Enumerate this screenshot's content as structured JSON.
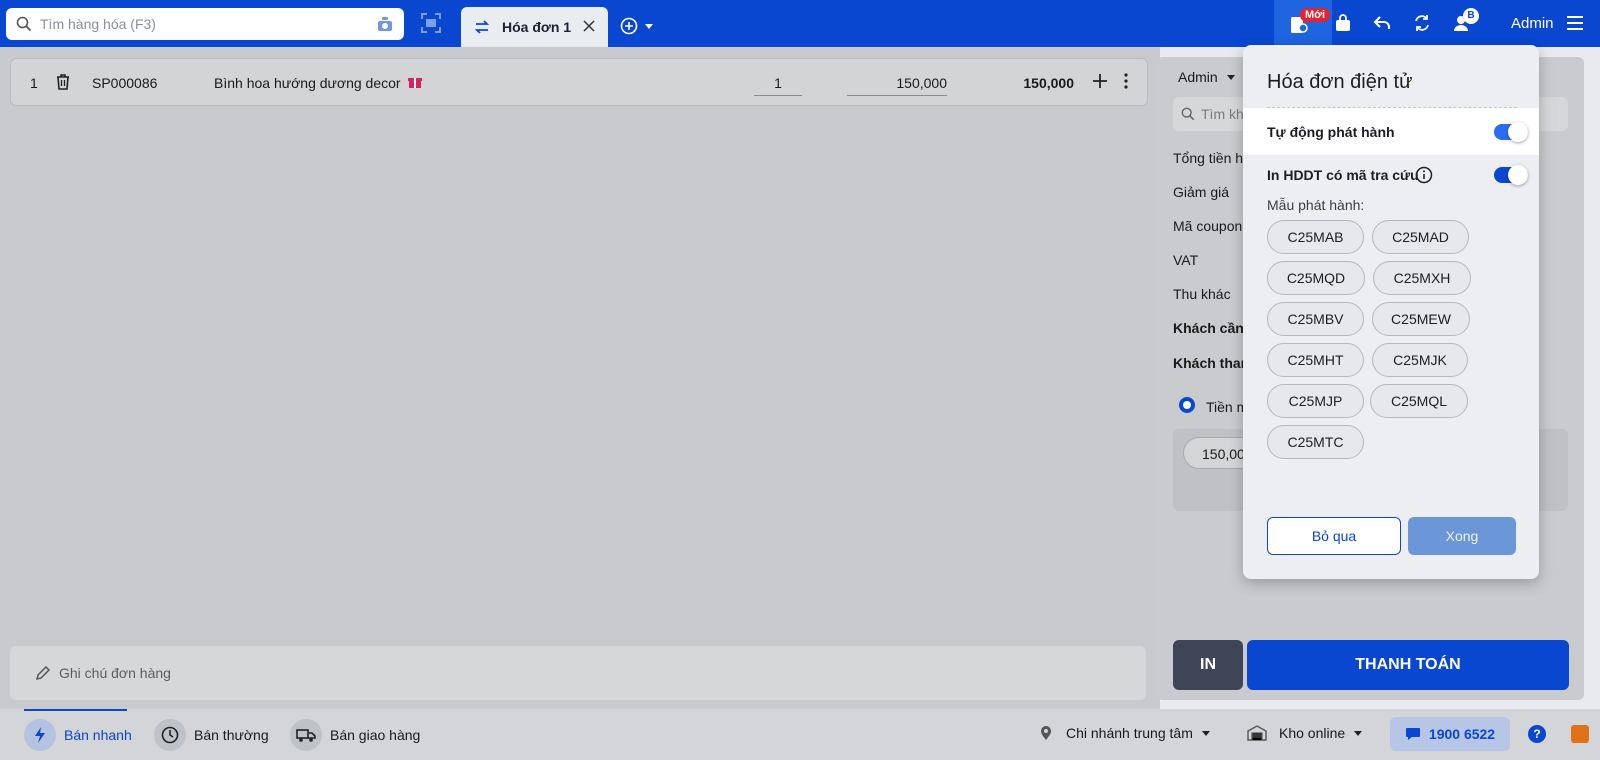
{
  "search": {
    "placeholder": "Tìm hàng hóa (F3)"
  },
  "tab": {
    "label": "Hóa đơn 1"
  },
  "top": {
    "new_badge": "Mới",
    "user_badge": "B",
    "admin": "Admin"
  },
  "item": {
    "index": "1",
    "code": "SP000086",
    "name": "Bình hoa hướng dương decor",
    "qty": "1",
    "price": "150,000",
    "total": "150,000"
  },
  "note": {
    "placeholder": "Ghi chú đơn hàng"
  },
  "right": {
    "seller": "Admin",
    "search_placeholder": "Tìm kh",
    "lines": [
      "Tổng tiền h",
      "Giảm giá",
      "Mã coupon",
      "VAT",
      "Thu khác"
    ],
    "bold_lines": [
      "Khách cần",
      "Khách than"
    ],
    "cash": "Tiền m",
    "amount": "150,00",
    "print": "IN",
    "pay": "THANH TOÁN"
  },
  "popup": {
    "title": "Hóa đơn điện tử",
    "auto_issue": "Tự động phát hành",
    "auto_issue_on": true,
    "print_lookup": "In HDDT có mã tra cứu",
    "print_lookup_on": true,
    "template_label": "Mẫu phát hành:",
    "templates": [
      "C25MAB",
      "C25MAD",
      "C25MQD",
      "C25MXH",
      "C25MBV",
      "C25MEW",
      "C25MHT",
      "C25MJK",
      "C25MJP",
      "C25MQL",
      "C25MTC"
    ],
    "skip": "Bỏ qua",
    "done": "Xong"
  },
  "bottom": {
    "fast": "Bán nhanh",
    "normal": "Bán thường",
    "delivery": "Bán giao hàng",
    "branch": "Chi nhánh trung tâm",
    "warehouse": "Kho online",
    "hotline": "1900 6522",
    "help": "?"
  },
  "colors": {
    "primary": "#0a47d1",
    "toggle": "#2a6df4",
    "danger": "#e5232e",
    "dark_button": "#3d4556"
  }
}
